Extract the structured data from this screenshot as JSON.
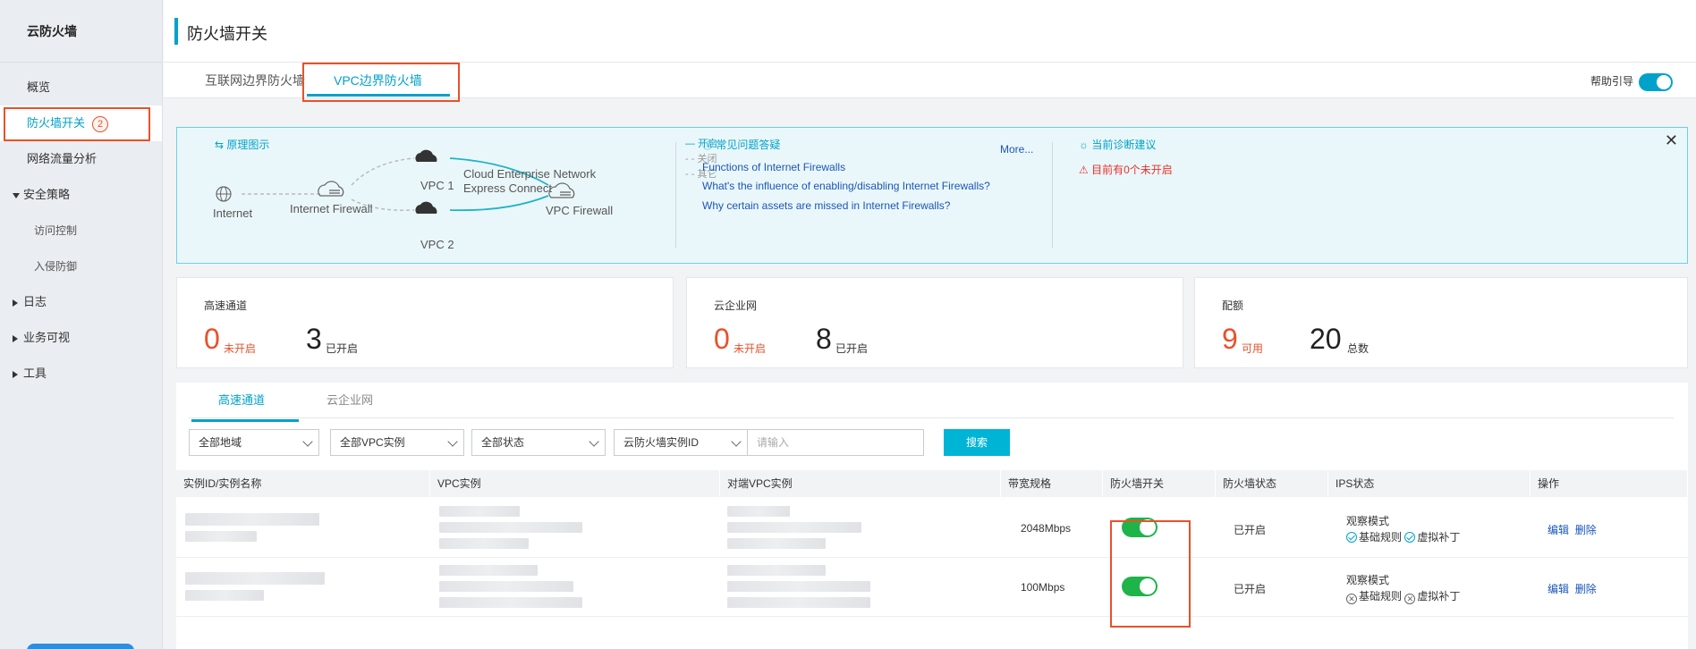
{
  "sidebar": {
    "title": "云防火墙",
    "items": [
      {
        "label": "概览"
      },
      {
        "label": "防火墙开关",
        "badge": "2"
      },
      {
        "label": "网络流量分析"
      },
      {
        "label": "安全策略"
      },
      {
        "label": "访问控制"
      },
      {
        "label": "入侵防御"
      },
      {
        "label": "日志"
      },
      {
        "label": "业务可视"
      },
      {
        "label": "工具"
      }
    ]
  },
  "header": {
    "title": "防火墙开关"
  },
  "tabs": [
    {
      "label": "互联网边界防火墙"
    },
    {
      "label": "VPC边界防火墙"
    }
  ],
  "help": {
    "label": "帮助引导"
  },
  "banner": {
    "principle_title": "原理图示",
    "legend": {
      "on": "— 开启",
      "off": "- - 关闭",
      "other": "- - 其它"
    },
    "diagram": {
      "internet": "Internet",
      "internet_fw": "Internet Firewall",
      "vpc1": "VPC 1",
      "vpc2": "VPC 2",
      "cen": "Cloud Enterprise Network",
      "ec": "Express Connect",
      "vpc_fw": "VPC Firewall"
    },
    "faq_title": "常见问题答疑",
    "faq_more": "More...",
    "faq_links": [
      "Functions of Internet Firewalls",
      "What's the influence of enabling/disabling Internet Firewalls?",
      "Why certain assets are missed in Internet Firewalls?"
    ],
    "diag_title": "当前诊断建议",
    "diag_warn": "目前有0个未开启"
  },
  "cards": [
    {
      "label": "高速通道",
      "n1": "0",
      "u1": "未开启",
      "n2": "3",
      "u2": "已开启"
    },
    {
      "label": "云企业网",
      "n1": "0",
      "u1": "未开启",
      "n2": "8",
      "u2": "已开启"
    },
    {
      "label": "配额",
      "n1": "9",
      "u1": "可用",
      "n2": "20",
      "u2": "总数"
    }
  ],
  "panel": {
    "tabs": [
      {
        "label": "高速通道"
      },
      {
        "label": "云企业网"
      }
    ],
    "filters": {
      "region": "全部地域",
      "vpc": "全部VPC实例",
      "status": "全部状态",
      "id_type": "云防火墙实例ID",
      "input_placeholder": "请输入",
      "search": "搜索"
    },
    "columns": [
      "实例ID/实例名称",
      "VPC实例",
      "对端VPC实例",
      "带宽规格",
      "防火墙开关",
      "防火墙状态",
      "IPS状态",
      "操作"
    ],
    "rows": [
      {
        "bandwidth": "2048Mbps",
        "fw_status": "已开启",
        "ips_mode": "观察模式",
        "ips_basic": "基础规则",
        "ips_patch": "虚拟补丁",
        "edit": "编辑",
        "delete": "删除"
      },
      {
        "bandwidth": "100Mbps",
        "fw_status": "已开启",
        "ips_mode": "观察模式",
        "ips_basic": "基础规则",
        "ips_patch": "虚拟补丁",
        "edit": "编辑",
        "delete": "删除"
      }
    ]
  }
}
